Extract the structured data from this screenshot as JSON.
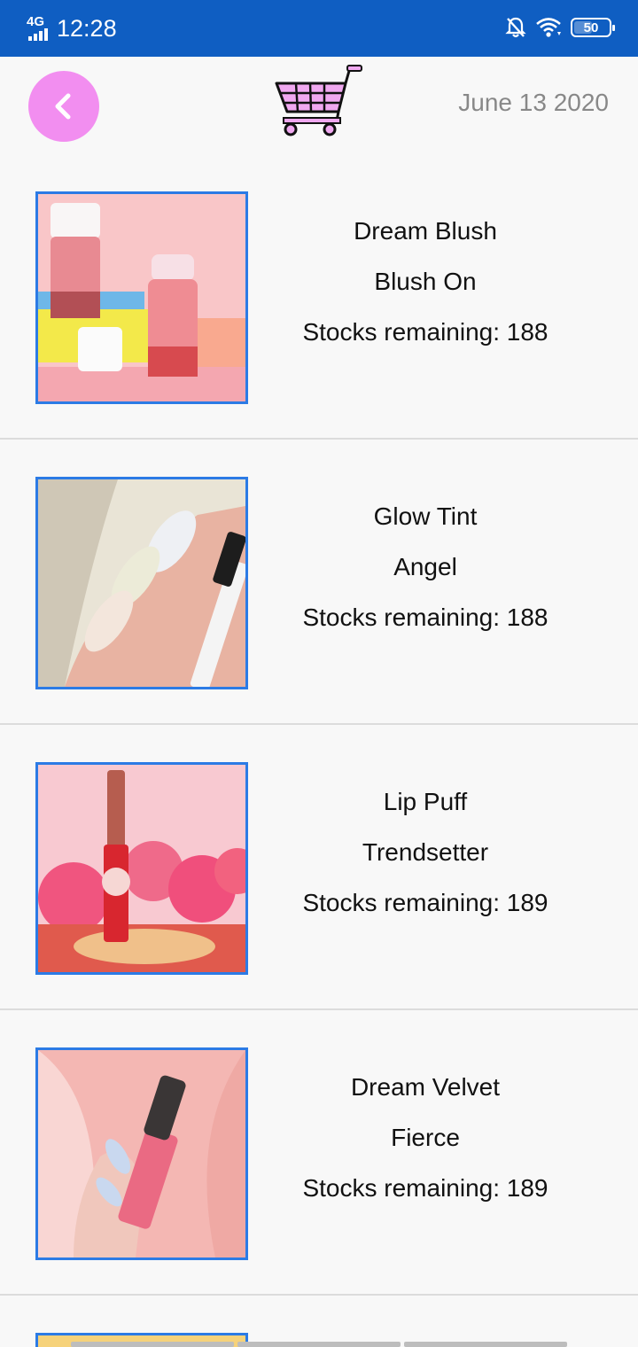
{
  "status_bar": {
    "network": "4G",
    "time": "12:28",
    "battery": "50"
  },
  "header": {
    "date": "June 13 2020",
    "back_icon": "chevron-left-icon",
    "cart_icon": "shopping-cart-icon"
  },
  "products": [
    {
      "name": "Dream Blush",
      "shade": "Blush On",
      "stock": "Stocks remaining: 188"
    },
    {
      "name": "Glow Tint",
      "shade": "Angel",
      "stock": "Stocks remaining: 188"
    },
    {
      "name": "Lip Puff",
      "shade": "Trendsetter",
      "stock": "Stocks remaining: 189"
    },
    {
      "name": "Dream Velvet",
      "shade": "Fierce",
      "stock": "Stocks remaining: 189"
    }
  ],
  "colors": {
    "status_bar": "#0f5ec2",
    "back_button": "#f28ef0",
    "thumb_border": "#2c7be5",
    "cart": "#f0a8f0"
  }
}
